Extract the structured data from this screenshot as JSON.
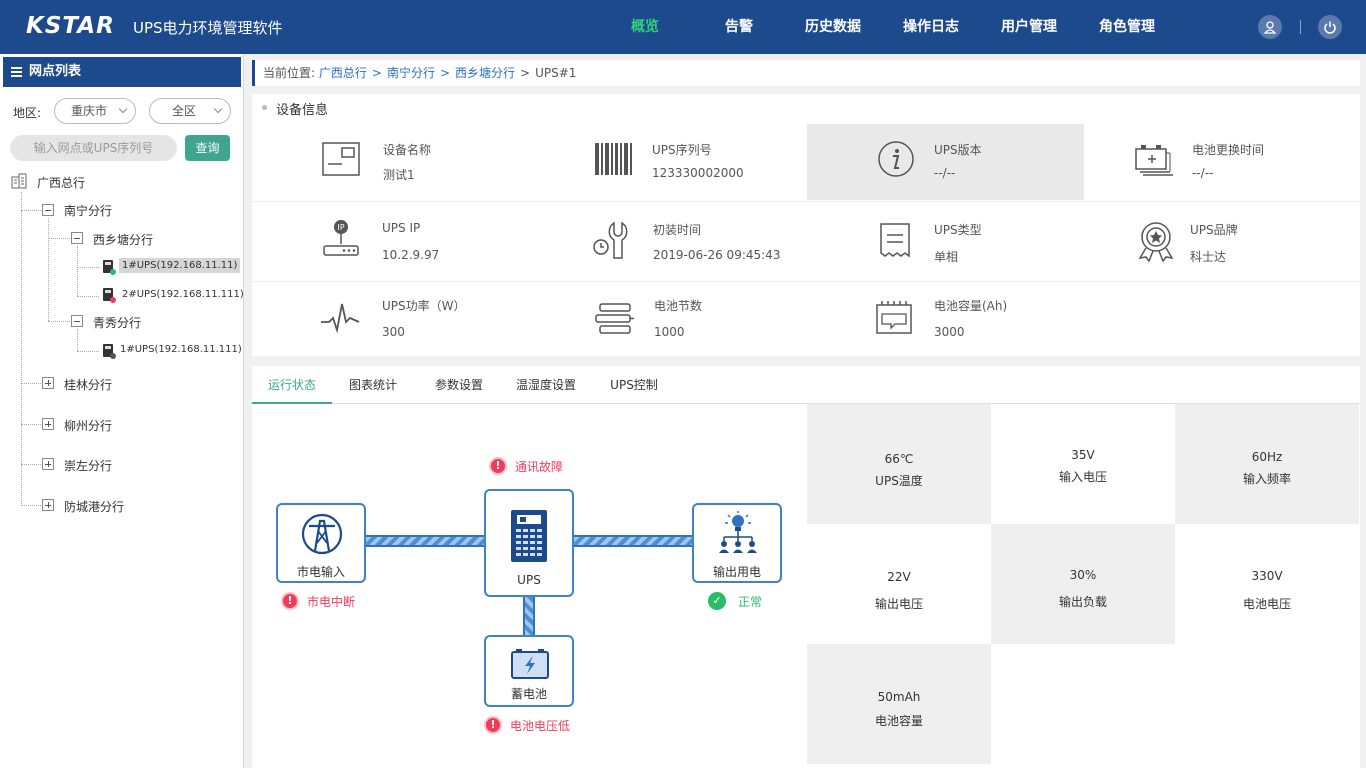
{
  "header": {
    "logo": "KSTAR",
    "title": "UPS电力环境管理软件",
    "nav": [
      "概览",
      "告警",
      "历史数据",
      "操作日志",
      "用户管理",
      "角色管理"
    ],
    "active_nav": "概览"
  },
  "sidebar": {
    "heading": "网点列表",
    "region_label": "地区:",
    "region_city": "重庆市",
    "region_district": "全区",
    "search_placeholder": "输入网点或UPS序列号",
    "query_button": "查询",
    "tree": {
      "root": "广西总行",
      "nanning": "南宁分行",
      "xixiangtang": "西乡塘分行",
      "ups1": "1#UPS(192.168.11.11)",
      "ups2": "2#UPS(192.168.11.111)",
      "qingxiu": "青秀分行",
      "ups3": "1#UPS(192.168.11.111)",
      "guilin": "桂林分行",
      "liuzhou": "柳州分行",
      "chongzuo": "崇左分行",
      "fangchenggang": "防城港分行"
    }
  },
  "breadcrumb": {
    "prefix": "当前位置:",
    "items": [
      "广西总行",
      "南宁分行",
      "西乡塘分行"
    ],
    "current": "UPS#1",
    "sep": ">"
  },
  "device_info": {
    "title": "设备信息",
    "fields": [
      {
        "label": "设备名称",
        "value": "测试1",
        "icon": "device-card-icon"
      },
      {
        "label": "UPS序列号",
        "value": "123330002000",
        "icon": "barcode-icon"
      },
      {
        "label": "UPS版本",
        "value": "--/--",
        "icon": "info-icon"
      },
      {
        "label": "电池更换时间",
        "value": "--/--",
        "icon": "battery-replace-icon"
      },
      {
        "label": "UPS IP",
        "value": "10.2.9.97",
        "icon": "router-ip-icon"
      },
      {
        "label": "初装时间",
        "value": "2019-06-26 09:45:43",
        "icon": "wrench-clock-icon"
      },
      {
        "label": "UPS类型",
        "value": "单相",
        "icon": "receipt-icon"
      },
      {
        "label": "UPS品牌",
        "value": "科士达",
        "icon": "award-badge-icon"
      },
      {
        "label": "UPS功率（W）",
        "value": "300",
        "icon": "pulse-icon"
      },
      {
        "label": "电池节数",
        "value": "1000",
        "icon": "battery-stack-icon"
      },
      {
        "label": "电池容量(Ah)",
        "value": "3000",
        "icon": "battery-capacity-icon"
      }
    ]
  },
  "tabs": [
    "运行状态",
    "图表统计",
    "参数设置",
    "温湿度设置",
    "UPS控制"
  ],
  "active_tab": "运行状态",
  "diagram": {
    "mains": "市电输入",
    "ups": "UPS",
    "output": "输出用电",
    "battery": "蓄电池",
    "status_comm": "通讯故障",
    "status_mains": "市电中断",
    "status_output": "正常",
    "status_battery": "电池电压低",
    "warn_glyph": "!",
    "ok_glyph": "✓"
  },
  "metrics": [
    {
      "value": "66℃",
      "label": "UPS温度"
    },
    {
      "value": "35V",
      "label": "输入电压"
    },
    {
      "value": "60Hz",
      "label": "输入频率"
    },
    {
      "value": "22V",
      "label": "输出电压"
    },
    {
      "value": "30%",
      "label": "输出负载"
    },
    {
      "value": "330V",
      "label": "电池电压"
    },
    {
      "value": "50mAh",
      "label": "电池容量"
    }
  ],
  "colors": {
    "header_bg": "#1c4a8c",
    "active_nav": "#2fd07a",
    "accent": "#3fa58e",
    "alert": "#f03c5a",
    "ok": "#2bbd6a",
    "diagram_blue": "#3f82c6"
  }
}
